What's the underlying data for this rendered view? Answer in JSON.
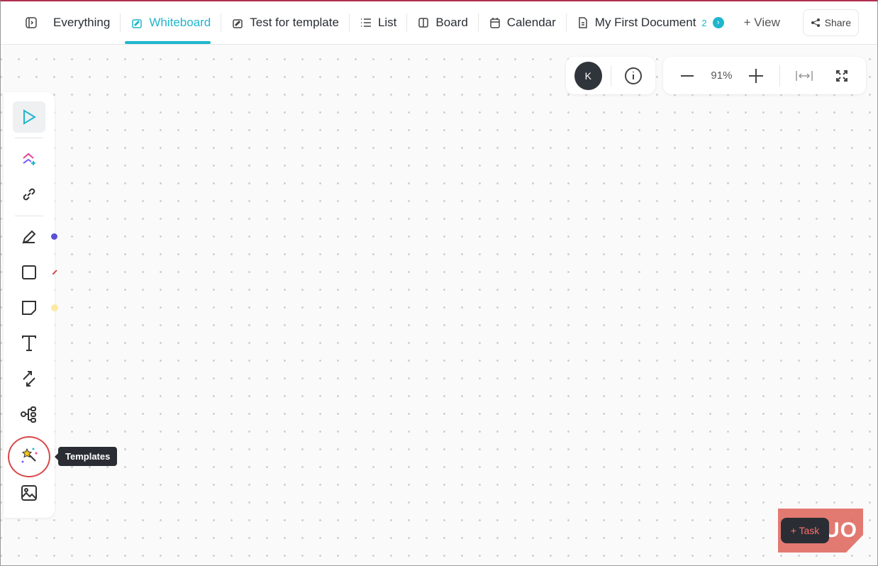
{
  "header": {
    "tabs": [
      {
        "label": "Everything",
        "icon": "sidebar-toggle-icon"
      },
      {
        "label": "Whiteboard",
        "icon": "whiteboard-icon",
        "active": true
      },
      {
        "label": "Test for template",
        "icon": "whiteboard-icon"
      },
      {
        "label": "List",
        "icon": "list-icon"
      },
      {
        "label": "Board",
        "icon": "board-icon"
      },
      {
        "label": "Calendar",
        "icon": "calendar-icon"
      },
      {
        "label": "My First Document",
        "icon": "document-icon"
      }
    ],
    "more_count": "2",
    "add_view": "+ View",
    "share": "Share"
  },
  "canvas": {
    "avatar": "K",
    "zoom": "91%"
  },
  "toolbar": {
    "tooltip": "Templates",
    "pen_color": "#5b4fd6",
    "shape_color": "#d94848",
    "sticky_color": "#fde9a4"
  },
  "floating": {
    "task": "+ Task"
  },
  "watermark": {
    "logo": "MUO"
  },
  "colors": {
    "accent": "#1fb6cc"
  }
}
